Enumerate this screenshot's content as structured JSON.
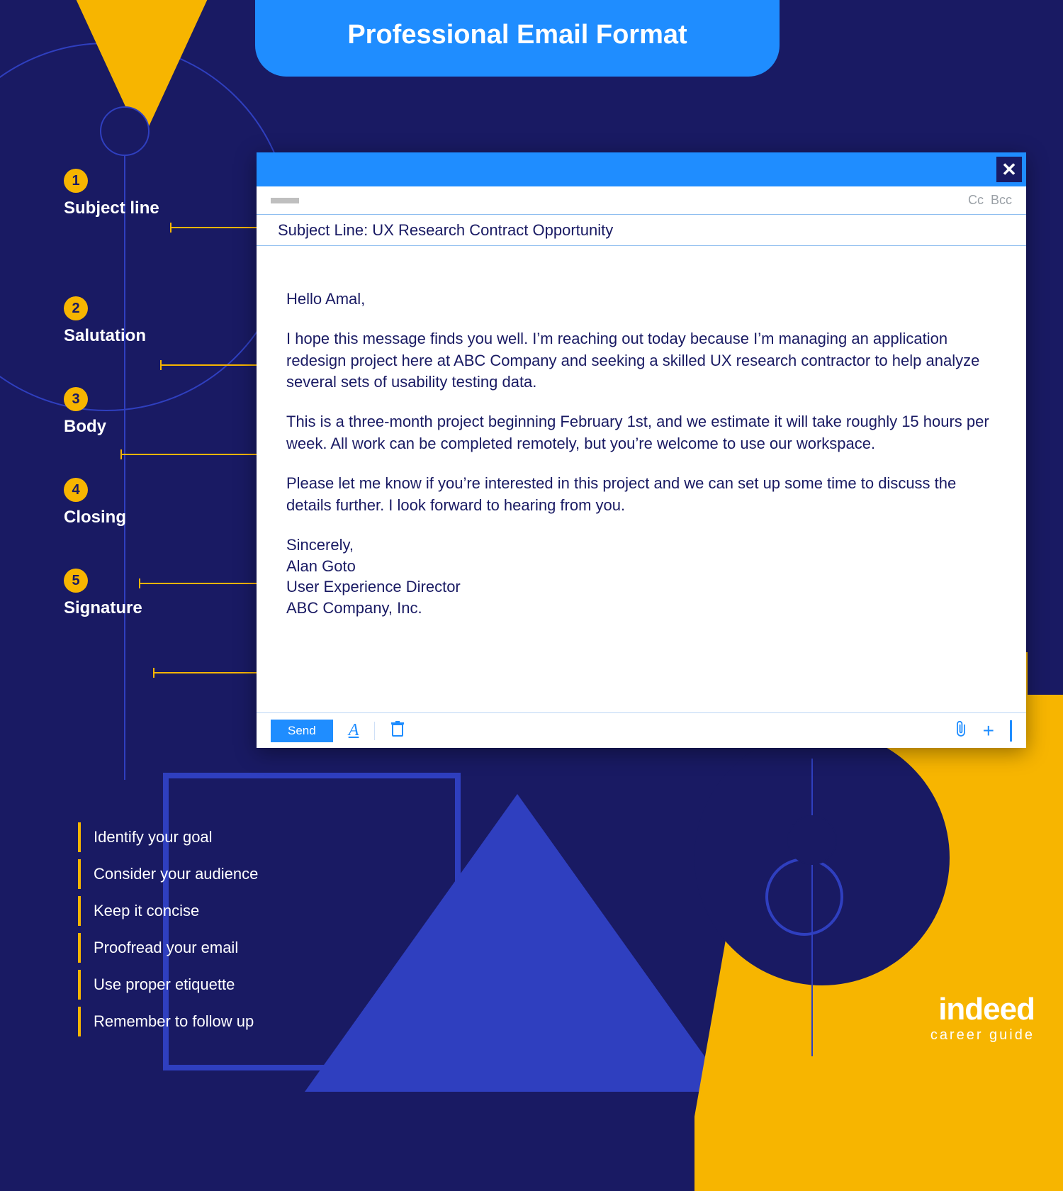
{
  "title": "Professional Email Format",
  "callouts": [
    {
      "num": "1",
      "label": "Subject line"
    },
    {
      "num": "2",
      "label": "Salutation"
    },
    {
      "num": "3",
      "label": "Body"
    },
    {
      "num": "4",
      "label": "Closing"
    },
    {
      "num": "5",
      "label": "Signature"
    }
  ],
  "tips": [
    "Identify your goal",
    "Consider your audience",
    "Keep it concise",
    "Proofread your email",
    "Use proper etiquette",
    "Remember to follow up"
  ],
  "email": {
    "cc_label": "Cc",
    "bcc_label": "Bcc",
    "subject": "Subject Line: UX Research Contract Opportunity",
    "salutation": "Hello Amal,",
    "body_p1": "I hope this message finds you well. I’m reaching out today because I’m managing an application redesign project here at ABC Company and seeking a skilled UX research contractor to help analyze several sets of usability testing data.",
    "body_p2": "This is a three-month project beginning February 1st, and we estimate it will take roughly 15 hours per week. All work can be completed remotely, but you’re welcome to use our workspace.",
    "closing": "Please let me know if you’re interested in this project and we can set up some time to discuss the details further. I look forward to hearing from you.",
    "sig_valediction": "Sincerely,",
    "sig_name": "Alan Goto",
    "sig_title": "User Experience Director",
    "sig_company": "ABC Company, Inc.",
    "send_label": "Send"
  },
  "logo": {
    "brand": "indeed",
    "sub": "career guide"
  }
}
